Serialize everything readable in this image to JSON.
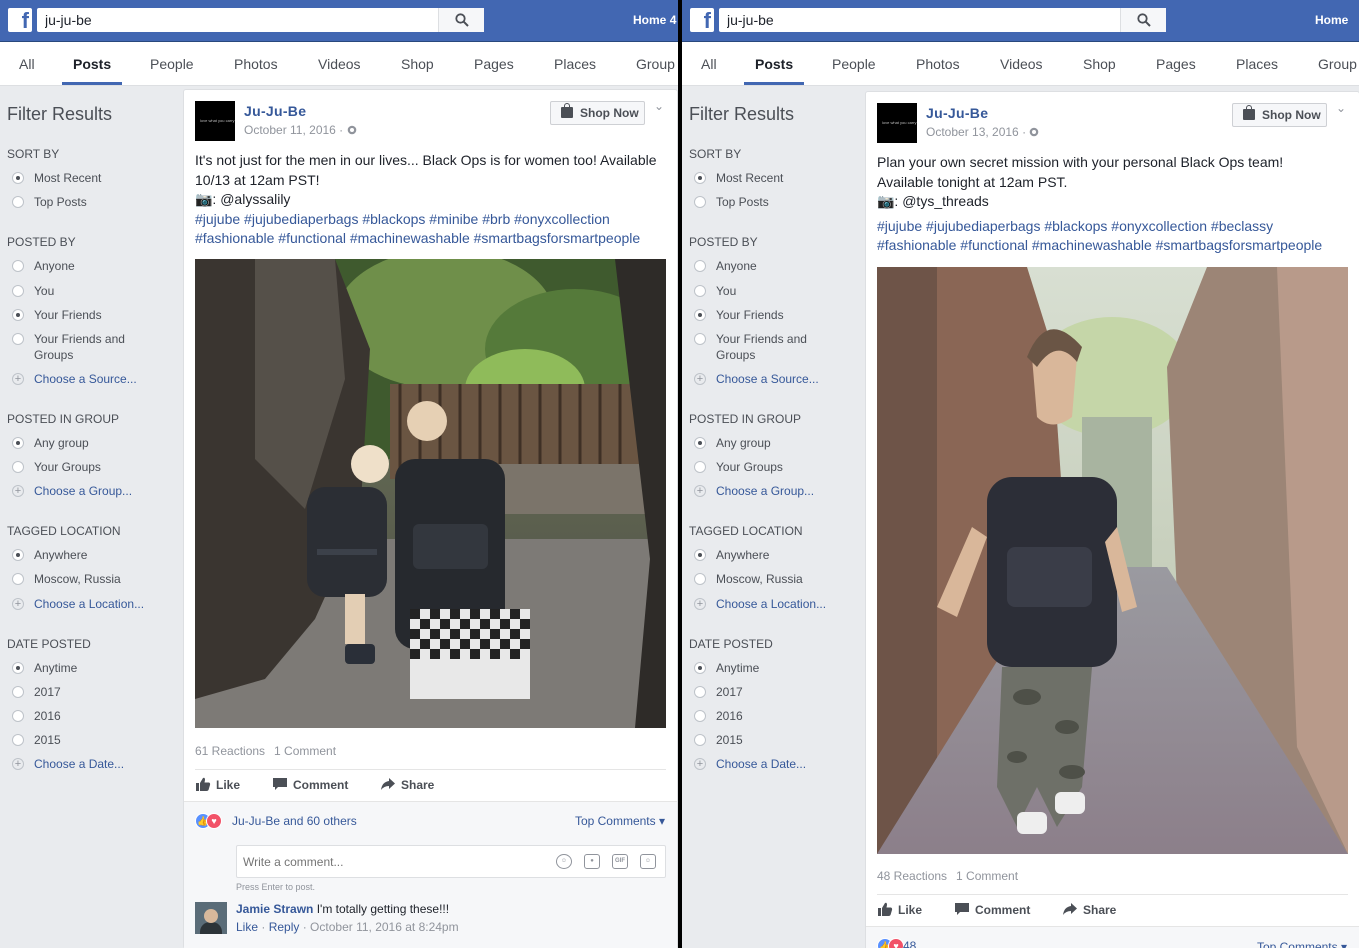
{
  "brand": {
    "logo_letter": "f"
  },
  "colors": {
    "header_blue": "#4267b2",
    "link_blue": "#365899",
    "background": "#e9ebee"
  },
  "left": {
    "search": {
      "value": "ju-ju-be"
    },
    "home_label": "Home",
    "home_overflow": "4",
    "tabs": [
      "All",
      "Posts",
      "People",
      "Photos",
      "Videos",
      "Shop",
      "Pages",
      "Places",
      "Group"
    ],
    "filters": {
      "title": "Filter Results",
      "sort_by": {
        "title": "SORT BY",
        "options": [
          "Most Recent",
          "Top Posts"
        ]
      },
      "posted_by": {
        "title": "POSTED BY",
        "options": [
          "Anyone",
          "You",
          "Your Friends",
          "Your Friends and Groups"
        ],
        "choose": "Choose a Source..."
      },
      "posted_in_group": {
        "title": "POSTED IN GROUP",
        "options": [
          "Any group",
          "Your Groups"
        ],
        "choose": "Choose a Group..."
      },
      "tagged_location": {
        "title": "TAGGED LOCATION",
        "options": [
          "Anywhere",
          "Moscow, Russia"
        ],
        "choose": "Choose a Location..."
      },
      "date_posted": {
        "title": "DATE POSTED",
        "options": [
          "Anytime",
          "2017",
          "2016",
          "2015"
        ],
        "choose": "Choose a Date..."
      }
    },
    "post": {
      "page_name": "Ju-Ju-Be",
      "avatar_text": "love what you carry",
      "date": "October 11, 2016 · ",
      "shop_button": "Shop Now",
      "chevron": "⌄",
      "text_line1": "It's not just for the men in our lives... Black Ops is for women too! Available",
      "text_line2": "10/13 at 12am PST!",
      "credit": "📷: @alyssalily",
      "hashtags_line1": "#jujube #jujubediaperbags #blackops #minibe #brb #onyxcollection",
      "hashtags_line2": "#fashionable #functional #machinewashable #smartbagsforsmartpeople",
      "reactions": "61 Reactions",
      "comments_count": "1 Comment",
      "actions": {
        "like": "Like",
        "comment": "Comment",
        "share": "Share"
      },
      "liked_by": "Ju-Ju-Be and 60 others",
      "top_comments": "Top Comments ▾",
      "comment_placeholder": "Write a comment...",
      "gif_label": "GIF",
      "press_enter": "Press Enter to post.",
      "comment": {
        "author": "Jamie Strawn",
        "text": " I'm totally getting these!!!",
        "like": "Like",
        "reply": "Reply",
        "sep": " · ",
        "time": "October 11, 2016 at 8:24pm"
      }
    }
  },
  "right": {
    "search": {
      "value": "ju-ju-be"
    },
    "home_label": "Home",
    "tabs": [
      "All",
      "Posts",
      "People",
      "Photos",
      "Videos",
      "Shop",
      "Pages",
      "Places",
      "Group"
    ],
    "filters": {
      "title": "Filter Results",
      "sort_by": {
        "title": "SORT BY",
        "options": [
          "Most Recent",
          "Top Posts"
        ]
      },
      "posted_by": {
        "title": "POSTED BY",
        "options": [
          "Anyone",
          "You",
          "Your Friends",
          "Your Friends and Groups"
        ],
        "choose": "Choose a Source..."
      },
      "posted_in_group": {
        "title": "POSTED IN GROUP",
        "options": [
          "Any group",
          "Your Groups"
        ],
        "choose": "Choose a Group..."
      },
      "tagged_location": {
        "title": "TAGGED LOCATION",
        "options": [
          "Anywhere",
          "Moscow, Russia"
        ],
        "choose": "Choose a Location..."
      },
      "date_posted": {
        "title": "DATE POSTED",
        "options": [
          "Anytime",
          "2017",
          "2016",
          "2015"
        ],
        "choose": "Choose a Date..."
      }
    },
    "post": {
      "page_name": "Ju-Ju-Be",
      "avatar_text": "love what you carry",
      "date": "October 13, 2016 · ",
      "shop_button": "Shop Now",
      "chevron": "⌄",
      "text_line1": "Plan your own secret mission with your personal Black Ops team!",
      "text_line2": "Available tonight at 12am PST.",
      "credit": "📷: @tys_threads",
      "hashtags_line1": "#jujube #jujubediaperbags #blackops #onyxcollection #beclassy",
      "hashtags_line2": "#fashionable #functional #machinewashable #smartbagsforsmartpeople",
      "reactions": "48 Reactions",
      "comments_count": "1 Comment",
      "actions": {
        "like": "Like",
        "comment": "Comment",
        "share": "Share"
      },
      "liked_by": "48",
      "top_comments": "Top Comments ▾"
    }
  }
}
